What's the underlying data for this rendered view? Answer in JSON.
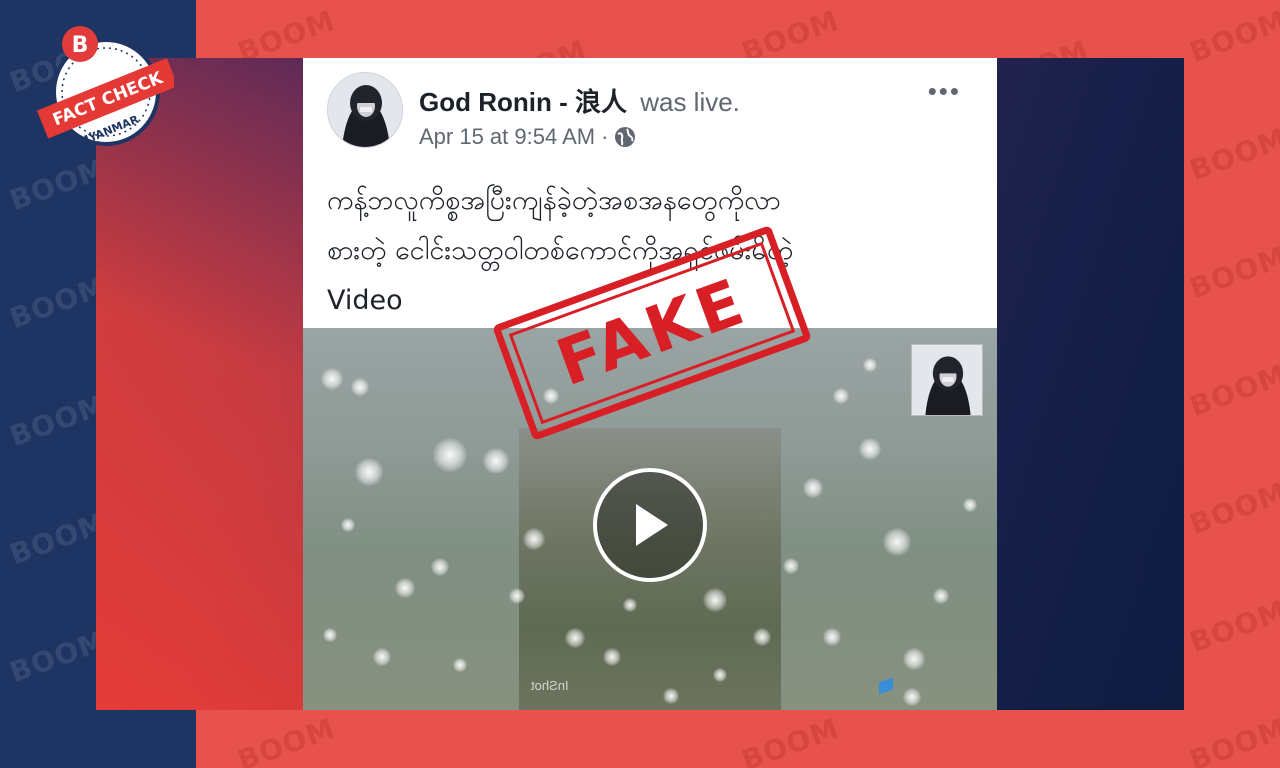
{
  "watermark_text": "BOOM",
  "logo": {
    "badge_letter": "B",
    "banner_text": "FACT CHECK",
    "region_text": "MYANMAR",
    "brand_color": "#e23b3b",
    "banner_color": "#e53935"
  },
  "post": {
    "author_name": "God Ronin - 浪人",
    "author_action": "was live.",
    "timestamp": "Apr 15 at 9:54 AM",
    "separator": "·",
    "privacy_icon": "globe-icon",
    "more_icon": "more-options-icon",
    "more_glyph": "•••",
    "text_lines": [
      "ကန့်ဘလူကိစ္စအပြီးကျန်ခဲ့တဲ့အစအနတွေကိုလာ",
      "စားတဲ့ ငေါင်းသတ္တဝါတစ်ကောင်ကိုအရှင်ဖမ်းမိတဲ့",
      "Video"
    ],
    "video": {
      "play_icon": "play-icon",
      "watermark": "InShot"
    }
  },
  "stamp": {
    "text": "FAKE",
    "color": "#d81f26"
  },
  "colors": {
    "background_red": "#e8524d",
    "left_band_navy": "#1e3563",
    "post_text": "#1d2129",
    "meta_gray": "#606770"
  }
}
